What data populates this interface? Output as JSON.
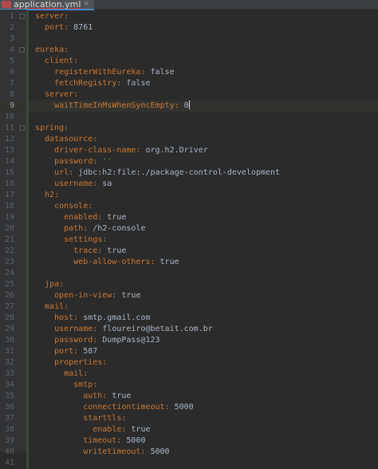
{
  "tab": {
    "title": "application.yml",
    "close_glyph": "×",
    "icon": "yaml-file-icon"
  },
  "editor": {
    "current_line": 9,
    "lines": [
      {
        "n": "1",
        "indent": 0,
        "key": "server:",
        "val": ""
      },
      {
        "n": "2",
        "indent": 2,
        "key": "port:",
        "val": " 8761"
      },
      {
        "n": "3",
        "indent": 0,
        "key": "",
        "val": ""
      },
      {
        "n": "4",
        "indent": 0,
        "key": "eureka:",
        "val": ""
      },
      {
        "n": "5",
        "indent": 2,
        "key": "client:",
        "val": ""
      },
      {
        "n": "6",
        "indent": 4,
        "key": "registerWithEureka:",
        "val": " false"
      },
      {
        "n": "7",
        "indent": 4,
        "key": "fetchRegistry:",
        "val": " false"
      },
      {
        "n": "8",
        "indent": 2,
        "key": "server:",
        "val": ""
      },
      {
        "n": "9",
        "indent": 4,
        "key": "waitTimeInMsWhenSyncEmpty:",
        "val": " 0"
      },
      {
        "n": "10",
        "indent": 0,
        "key": "",
        "val": ""
      },
      {
        "n": "11",
        "indent": 0,
        "key": "spring:",
        "val": ""
      },
      {
        "n": "12",
        "indent": 2,
        "key": "datasource:",
        "val": ""
      },
      {
        "n": "13",
        "indent": 4,
        "key": "driver-class-name:",
        "val": " org.h2.Driver"
      },
      {
        "n": "14",
        "indent": 4,
        "key": "password:",
        "val": " ''",
        "str": true
      },
      {
        "n": "15",
        "indent": 4,
        "key": "url:",
        "val": " jdbc:h2:file:./package-control-development"
      },
      {
        "n": "16",
        "indent": 4,
        "key": "username:",
        "val": " sa"
      },
      {
        "n": "17",
        "indent": 2,
        "key": "h2:",
        "val": ""
      },
      {
        "n": "18",
        "indent": 4,
        "key": "console:",
        "val": ""
      },
      {
        "n": "19",
        "indent": 6,
        "key": "enabled:",
        "val": " true"
      },
      {
        "n": "20",
        "indent": 6,
        "key": "path:",
        "val": " /h2-console"
      },
      {
        "n": "21",
        "indent": 6,
        "key": "settings:",
        "val": ""
      },
      {
        "n": "22",
        "indent": 8,
        "key": "trace:",
        "val": " true"
      },
      {
        "n": "23",
        "indent": 8,
        "key": "web-allow-others:",
        "val": " true"
      },
      {
        "n": "24",
        "indent": 0,
        "key": "",
        "val": ""
      },
      {
        "n": "25",
        "indent": 2,
        "key": "jpa:",
        "val": ""
      },
      {
        "n": "26",
        "indent": 4,
        "key": "open-in-view:",
        "val": " true"
      },
      {
        "n": "27",
        "indent": 2,
        "key": "mail:",
        "val": ""
      },
      {
        "n": "28",
        "indent": 4,
        "key": "host:",
        "val": " smtp.gmail.com"
      },
      {
        "n": "29",
        "indent": 4,
        "key": "username:",
        "val": " floureiro@betait.com.br"
      },
      {
        "n": "30",
        "indent": 4,
        "key": "password:",
        "val": " DumpPass@123"
      },
      {
        "n": "31",
        "indent": 4,
        "key": "port:",
        "val": " 587"
      },
      {
        "n": "32",
        "indent": 4,
        "key": "properties:",
        "val": ""
      },
      {
        "n": "33",
        "indent": 6,
        "key": "mail:",
        "val": ""
      },
      {
        "n": "34",
        "indent": 8,
        "key": "smtp:",
        "val": ""
      },
      {
        "n": "35",
        "indent": 10,
        "key": "auth:",
        "val": " true"
      },
      {
        "n": "36",
        "indent": 10,
        "key": "connectiontimeout:",
        "val": " 5000"
      },
      {
        "n": "37",
        "indent": 10,
        "key": "starttls:",
        "val": ""
      },
      {
        "n": "38",
        "indent": 12,
        "key": "enable:",
        "val": " true"
      },
      {
        "n": "39",
        "indent": 10,
        "key": "timeout:",
        "val": " 5000"
      },
      {
        "n": "40",
        "indent": 10,
        "key": "writetimeout:",
        "val": " 5000"
      },
      {
        "n": "41",
        "indent": 0,
        "key": "",
        "val": ""
      }
    ]
  },
  "colors": {
    "background": "#2b2b2b",
    "key": "#cc7832",
    "value": "#a9b7c6",
    "string": "#6a8759",
    "line_number": "#606366"
  }
}
